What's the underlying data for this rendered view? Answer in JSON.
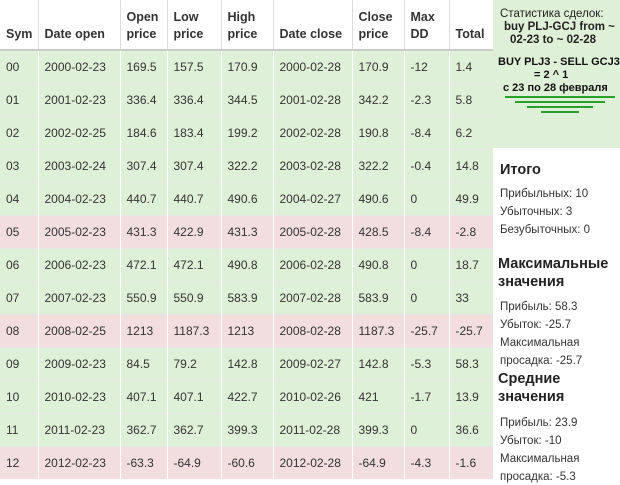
{
  "table": {
    "headers": [
      {
        "l1": "Sym",
        "l2": ""
      },
      {
        "l1": "Date open",
        "l2": ""
      },
      {
        "l1": "Open",
        "l2": "price"
      },
      {
        "l1": "Low",
        "l2": "price"
      },
      {
        "l1": "High",
        "l2": "price"
      },
      {
        "l1": "Date close",
        "l2": ""
      },
      {
        "l1": "Close",
        "l2": "price"
      },
      {
        "l1": "Max",
        "l2": "DD"
      },
      {
        "l1": "Total",
        "l2": ""
      }
    ],
    "rows": [
      {
        "outcome": "win",
        "cells": [
          "00",
          "2000-02-23",
          "169.5",
          "157.5",
          "170.9",
          "2000-02-28",
          "170.9",
          "-12",
          "1.4"
        ]
      },
      {
        "outcome": "win",
        "cells": [
          "01",
          "2001-02-23",
          "336.4",
          "336.4",
          "344.5",
          "2001-02-28",
          "342.2",
          "-2.3",
          "5.8"
        ]
      },
      {
        "outcome": "win",
        "cells": [
          "02",
          "2002-02-25",
          "184.6",
          "183.4",
          "199.2",
          "2002-02-28",
          "190.8",
          "-8.4",
          "6.2"
        ]
      },
      {
        "outcome": "win",
        "cells": [
          "03",
          "2003-02-24",
          "307.4",
          "307.4",
          "322.2",
          "2003-02-28",
          "322.2",
          "-0.4",
          "14.8"
        ]
      },
      {
        "outcome": "win",
        "cells": [
          "04",
          "2004-02-23",
          "440.7",
          "440.7",
          "490.6",
          "2004-02-27",
          "490.6",
          "0",
          "49.9"
        ]
      },
      {
        "outcome": "loss",
        "cells": [
          "05",
          "2005-02-23",
          "431.3",
          "422.9",
          "431.3",
          "2005-02-28",
          "428.5",
          "-8.4",
          "-2.8"
        ]
      },
      {
        "outcome": "win",
        "cells": [
          "06",
          "2006-02-23",
          "472.1",
          "472.1",
          "490.8",
          "2006-02-28",
          "490.8",
          "0",
          "18.7"
        ]
      },
      {
        "outcome": "win",
        "cells": [
          "07",
          "2007-02-23",
          "550.9",
          "550.9",
          "583.9",
          "2007-02-28",
          "583.9",
          "0",
          "33"
        ]
      },
      {
        "outcome": "loss",
        "cells": [
          "08",
          "2008-02-25",
          "1213",
          "1187.3",
          "1213",
          "2008-02-28",
          "1187.3",
          "-25.7",
          "-25.7"
        ]
      },
      {
        "outcome": "win",
        "cells": [
          "09",
          "2009-02-23",
          "84.5",
          "79.2",
          "142.8",
          "2009-02-27",
          "142.8",
          "-5.3",
          "58.3"
        ]
      },
      {
        "outcome": "win",
        "cells": [
          "10",
          "2010-02-23",
          "407.1",
          "407.1",
          "422.7",
          "2010-02-26",
          "421",
          "-1.7",
          "13.9"
        ]
      },
      {
        "outcome": "win",
        "cells": [
          "11",
          "2011-02-23",
          "362.7",
          "362.7",
          "399.3",
          "2011-02-28",
          "399.3",
          "0",
          "36.6"
        ]
      },
      {
        "outcome": "loss",
        "cells": [
          "12",
          "2012-02-23",
          "-63.3",
          "-64.9",
          "-60.6",
          "2012-02-28",
          "-64.9",
          "-4.3",
          "-1.6"
        ]
      }
    ]
  },
  "side": {
    "stats_title": "Статистика сделок:",
    "stats_line2": "buy PLJ-GCJ from ~",
    "stats_line3": "02-23 to ~ 02-28",
    "signal_line1": "BUY PLJ3 - SELL GCJ3",
    "signal_line2": "= 2 ^ 1",
    "signal_line3": "с 23 по 28 февраля",
    "summary_heading": "Итого",
    "profitable": "Прибыльных: 10",
    "losing": "Убыточных: 3",
    "breakeven": "Безубыточных: 0",
    "max_heading_1": "Максимальные",
    "max_heading_2": "значения",
    "max_profit": "Прибыль: 58.3",
    "max_loss": "Убыток: -25.7",
    "max_dd_1": "Максимальная",
    "max_dd_2": "просадка: -25.7",
    "avg_heading_1": "Средние",
    "avg_heading_2": "значения",
    "avg_profit": "Прибыль: 23.9",
    "avg_loss": "Убыток: -10",
    "avg_dd_1": "Максимальная",
    "avg_dd_2": "просадка: -5.3"
  },
  "colors": {
    "win_row": "#dff0d8",
    "loss_row": "#f2dede",
    "signal_bars": "#2aa02a"
  }
}
